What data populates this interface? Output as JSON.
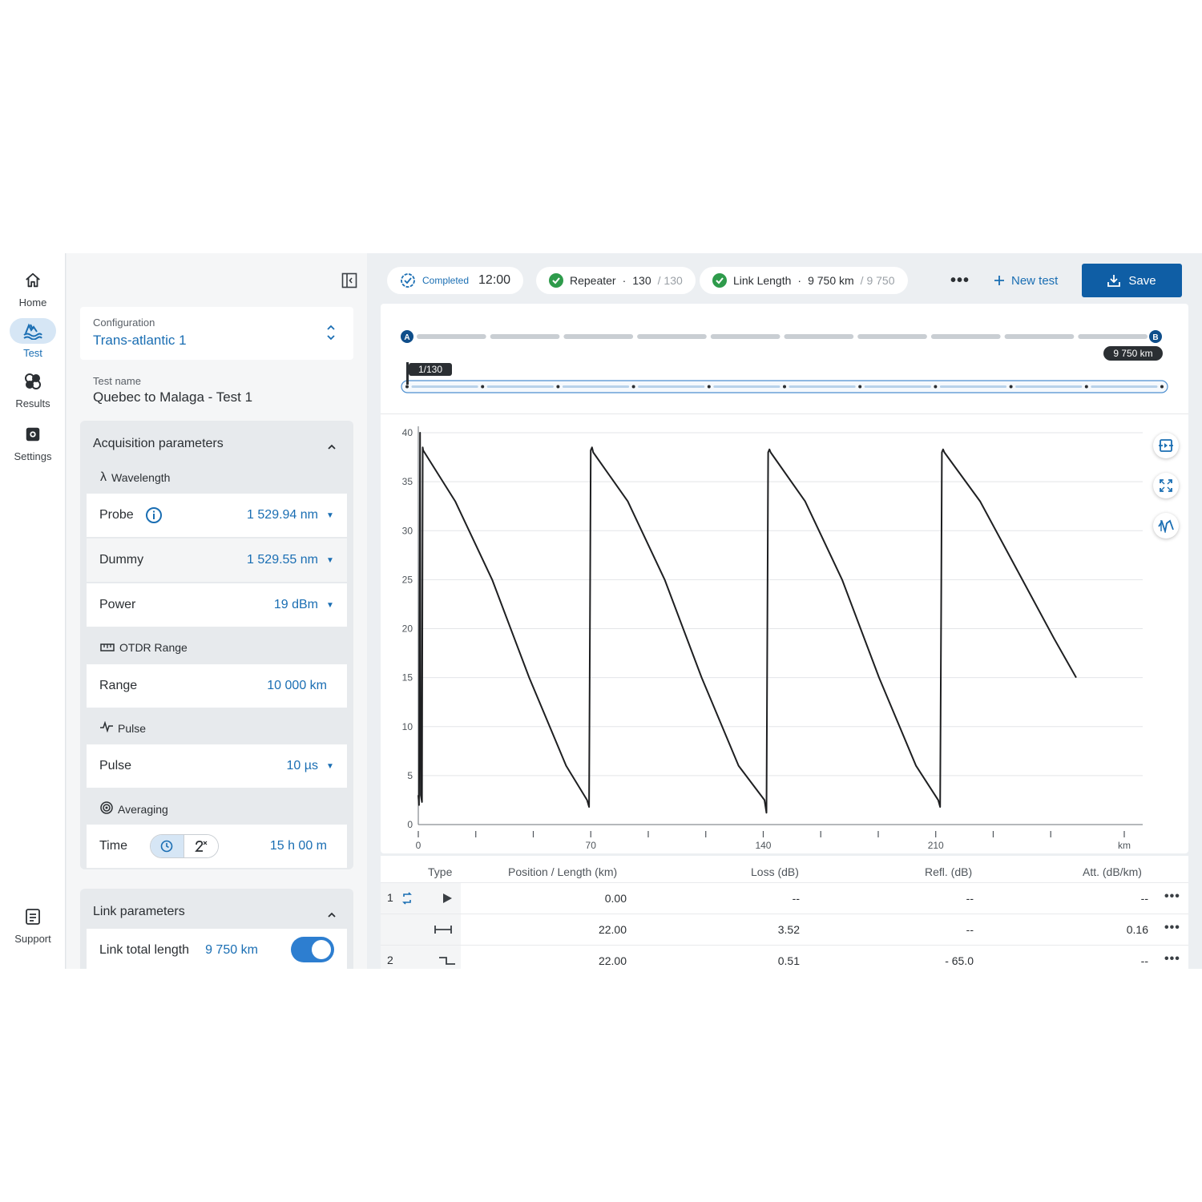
{
  "nav": {
    "items": [
      {
        "label": "Home",
        "icon": "home-icon"
      },
      {
        "label": "Test",
        "icon": "test-icon"
      },
      {
        "label": "Results",
        "icon": "results-icon"
      },
      {
        "label": "Settings",
        "icon": "settings-icon"
      }
    ],
    "support": {
      "label": "Support",
      "icon": "support-icon"
    }
  },
  "config": {
    "label": "Configuration",
    "value": "Trans-atlantic 1"
  },
  "test_name": {
    "label": "Test name",
    "value": "Quebec to Malaga - Test 1"
  },
  "acquisition": {
    "title": "Acquisition parameters",
    "wavelength_label": "Wavelength",
    "probe": {
      "label": "Probe",
      "value": "1 529.94 nm"
    },
    "dummy": {
      "label": "Dummy",
      "value": "1 529.55 nm"
    },
    "power": {
      "label": "Power",
      "value": "19 dBm"
    },
    "otdr_label": "OTDR Range",
    "range": {
      "label": "Range",
      "value": "10 000 km"
    },
    "pulse_label": "Pulse",
    "pulse": {
      "label": "Pulse",
      "value": "10 µs"
    },
    "averaging_label": "Averaging",
    "time": {
      "label": "Time",
      "value": "15 h 00 m"
    }
  },
  "link": {
    "title": "Link parameters",
    "total_length": {
      "label": "Link total length",
      "value": "9 750 km",
      "enabled": true
    }
  },
  "status": {
    "completed": {
      "label": "Completed",
      "time": "12:00"
    },
    "repeater": {
      "label": "Repeater",
      "sep": "·",
      "value": "130",
      "total": "/ 130"
    },
    "link_length": {
      "label": "Link Length",
      "sep": "·",
      "value": "9 750 km",
      "total": "/ 9 750"
    }
  },
  "toolbar": {
    "new_test": "New test",
    "save": "Save"
  },
  "span": {
    "start": "A",
    "end": "B",
    "end_length": "9 750 km",
    "marker": "1/130",
    "segments": 10,
    "mini_segments": 10
  },
  "colors": {
    "accent": "#1a6eb3",
    "save_bg": "#0f5ea5",
    "check": "#2e9b4b"
  },
  "chart_data": {
    "type": "line",
    "x_unit": "km",
    "xlim": [
      0,
      294
    ],
    "ylim": [
      0,
      40
    ],
    "x_ticks": [
      0,
      70,
      140,
      210
    ],
    "x_minor_ticks": [
      23.33,
      46.67,
      93.33,
      116.67,
      163.33,
      186.67,
      233.33,
      256.67
    ],
    "y_ticks": [
      0,
      5,
      10,
      15,
      20,
      25,
      30,
      35,
      40
    ],
    "grid": true,
    "series": [
      {
        "x": [
          0,
          0.3,
          0.7,
          1,
          1.5,
          1.8,
          2,
          15,
          30,
          45,
          60,
          68.5,
          69.3,
          69.7,
          70,
          70.5,
          71,
          85,
          100,
          115,
          130,
          140.5,
          141.3,
          141.7,
          142,
          142.5,
          143,
          157,
          172,
          187,
          202,
          211,
          211.8,
          212.2,
          212.5,
          213,
          213.5,
          228,
          243,
          258,
          267
        ],
        "y": [
          3,
          2,
          40,
          3,
          2.3,
          38.5,
          38.2,
          33,
          25,
          15,
          6,
          2.5,
          1.8,
          22,
          38.2,
          38.5,
          38,
          33,
          25,
          15,
          6,
          2.5,
          1.2,
          22,
          38,
          38.3,
          38,
          33,
          25,
          15,
          6,
          2.5,
          1.8,
          22,
          38,
          38.3,
          38,
          33,
          26,
          19,
          15
        ]
      }
    ]
  },
  "table": {
    "headers": [
      "Type",
      "Position / Length (km)",
      "Loss (dB)",
      "Refl. (dB)",
      "Att. (dB/km)"
    ],
    "rows": [
      {
        "index": "1",
        "type_icon": "launch-icon",
        "position": "0.00",
        "loss": "--",
        "refl": "--",
        "att": "--"
      },
      {
        "index": "",
        "type_icon": "span-icon",
        "position": "22.00",
        "loss": "3.52",
        "refl": "--",
        "att": "0.16"
      },
      {
        "index": "2",
        "type_icon": "step-icon",
        "position": "22.00",
        "loss": "0.51",
        "refl": "- 65.0",
        "att": "--"
      }
    ]
  }
}
